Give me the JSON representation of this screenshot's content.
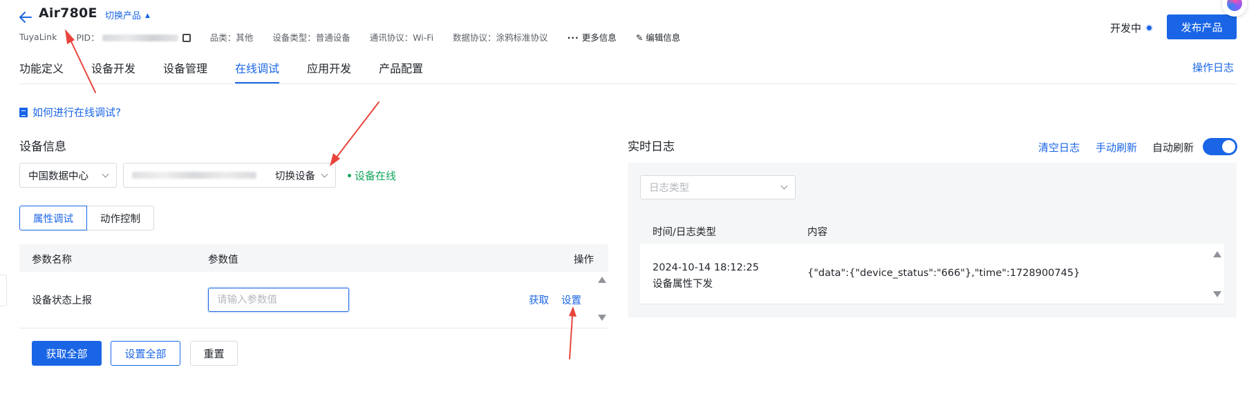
{
  "header": {
    "product_name": "Air780E",
    "switch_product": "切换产品",
    "platform": "TuyaLink",
    "pid_label": "PID：",
    "category": "品类：其他",
    "device_type": "设备类型：普通设备",
    "comm_protocol": "通讯协议：Wi-Fi",
    "data_protocol": "数据协议：涂鸦标准协议",
    "more_info": "更多信息",
    "edit_info": "编辑信息",
    "status": "开发中",
    "publish": "发布产品"
  },
  "tabs": [
    {
      "label": "功能定义",
      "active": false
    },
    {
      "label": "设备开发",
      "active": false
    },
    {
      "label": "设备管理",
      "active": false
    },
    {
      "label": "在线调试",
      "active": true
    },
    {
      "label": "应用开发",
      "active": false
    },
    {
      "label": "产品配置",
      "active": false
    }
  ],
  "operation_log": "操作日志",
  "howto": "如何进行在线调试?",
  "device_info": {
    "title": "设备信息",
    "data_center": "中国数据中心",
    "switch_device": "切换设备",
    "online_status": "设备在线"
  },
  "segments": {
    "property": "属性调试",
    "action": "动作控制"
  },
  "param_table": {
    "headers": [
      "参数名称",
      "参数值",
      "操作"
    ],
    "rows": [
      {
        "name": "设备状态上报",
        "placeholder": "请输入参数值",
        "get": "获取",
        "set": "设置"
      }
    ]
  },
  "buttons": {
    "get_all": "获取全部",
    "set_all": "设置全部",
    "reset": "重置"
  },
  "log": {
    "title": "实时日志",
    "clear": "清空日志",
    "manual_refresh": "手动刷新",
    "auto_refresh": "自动刷新",
    "auto_refresh_on": true,
    "type_placeholder": "日志类型",
    "headers": [
      "时间/日志类型",
      "内容"
    ],
    "entries": [
      {
        "time": "2024-10-14 18:12:25",
        "type": "设备属性下发",
        "content": "{\"data\":{\"device_status\":\"666\"},\"time\":1728900745}"
      }
    ]
  },
  "colors": {
    "accent": "#1965e6",
    "online": "#12a45b",
    "annotation": "#e8453c"
  }
}
